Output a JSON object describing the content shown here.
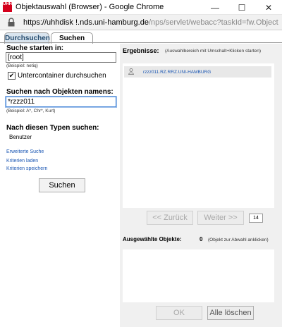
{
  "window": {
    "logo_text": "UHH",
    "title": "Objektauswahl (Browser) - Google Chrome",
    "minimize": "—",
    "maximize": "☐",
    "close": "✕"
  },
  "address": {
    "host": "https://uhhdisk !.nds.uni-hamburg.de",
    "path": "/nps/servlet/webacc?taskId=fw.ObjectSel..."
  },
  "tabs": [
    {
      "label": "Durchsuchen",
      "active": false
    },
    {
      "label": "Suchen",
      "active": true
    }
  ],
  "search": {
    "start_label": "Suche starten in:",
    "start_value": "[root]",
    "start_hint": "(Beispiel: netiq)",
    "subcontainer_label": "Untercontainer durchsuchen",
    "subcontainer_checked": true,
    "name_label": "Suchen nach Objekten namens:",
    "name_value": "*rzzz011",
    "name_hint": "(Beispiel: A*, Chr*, Kurt)",
    "types_label": "Nach diesen Typen suchen:",
    "types_value": "Benutzer",
    "link_advanced": "Erweiterte Suche",
    "link_load": "Kriterien laden",
    "link_save": "Kriterien speichern",
    "search_button": "Suchen"
  },
  "results": {
    "label": "Ergebnisse:",
    "hint": "(Auswahlbereich mit Umschalt+Klicken starten)",
    "items": [
      "rzzz011.RZ.RRZ.UNI-HAMBURG"
    ],
    "back_button": "<< Zurück",
    "next_button": "Weiter >>",
    "page_size": "14"
  },
  "selected": {
    "label": "Ausgewählte Objekte:",
    "count": "0",
    "hint": "(Objekt zur Abwahl anklicken)",
    "ok_button": "OK",
    "clear_button": "Alle löschen"
  },
  "colors": {
    "accent": "#1a56b3",
    "logo": "#d4001c"
  }
}
